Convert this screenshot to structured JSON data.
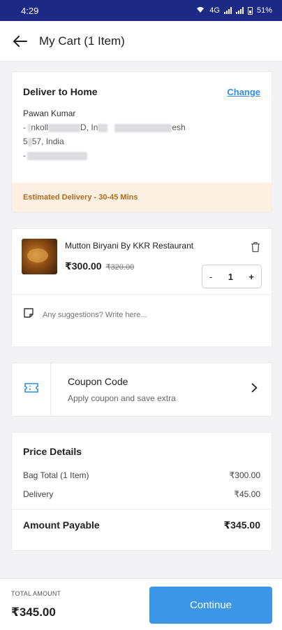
{
  "status_bar": {
    "time": "4:29",
    "network": "4G",
    "battery": "51%"
  },
  "header": {
    "title": "My Cart (1 Item)"
  },
  "delivery": {
    "title": "Deliver to Home",
    "change_label": "Change",
    "name": "Pawan Kumar",
    "address_line1_a": "- ",
    "address_line1_b": "nkoll",
    "address_line1_c": "D, In",
    "address_line1_d": "esh",
    "address_line2_a": "5",
    "address_line2_b": "57, India",
    "address_line3_a": "-",
    "eta": "Estimated Delivery - 30-45 Mins"
  },
  "cart_item": {
    "name": "Mutton Biryani By KKR Restaurant",
    "price": "₹300.00",
    "old_price": "₹320.00",
    "qty_minus": "-",
    "qty": "1",
    "qty_plus": "+",
    "note_placeholder": "Any suggestions? Write here..."
  },
  "coupon": {
    "title": "Coupon Code",
    "subtitle": "Apply coupon and save extra"
  },
  "price_details": {
    "title": "Price Details",
    "rows": [
      {
        "label": "Bag Total (1 Item)",
        "value": "₹300.00"
      },
      {
        "label": "Delivery",
        "value": "₹45.00"
      }
    ],
    "payable_label": "Amount Payable",
    "payable_value": "₹345.00"
  },
  "footer": {
    "total_label": "TOTAL AMOUNT",
    "total_value": "₹345.00",
    "continue_label": "Continue"
  },
  "colors": {
    "status_bar": "#1c2a86",
    "accent": "#3b96e8",
    "link": "#2f8de4",
    "eta_bg": "#fdf0e2",
    "eta_text": "#b26a1e"
  }
}
